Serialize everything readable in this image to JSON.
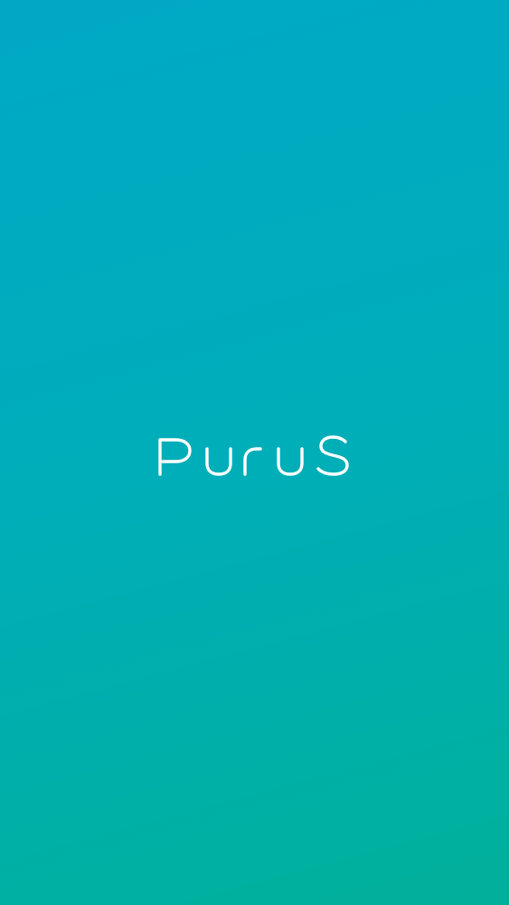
{
  "splash": {
    "logo_text": "purus",
    "background_top": "#00a8c6",
    "background_bottom": "#00b09a",
    "logo_color": "#ffffff"
  }
}
